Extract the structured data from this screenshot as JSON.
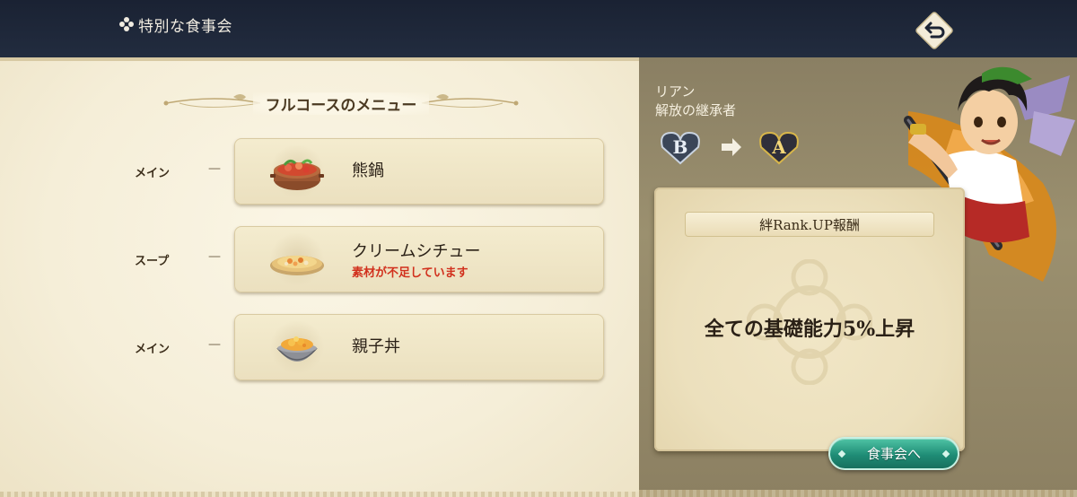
{
  "header": {
    "title": "特別な食事会",
    "title_icon": "flower-ornament-icon",
    "back_icon": "return-arrow-icon"
  },
  "menu": {
    "heading": "フルコースのメニュー",
    "courses": [
      {
        "category": "メイン",
        "dash": "—",
        "dish": "熊鍋",
        "warning": "",
        "icon": "bear-hotpot-icon"
      },
      {
        "category": "スープ",
        "dash": "—",
        "dish": "クリームシチュー",
        "warning": "素材が不足しています",
        "icon": "cream-stew-icon"
      },
      {
        "category": "メイン",
        "dash": "—",
        "dish": "親子丼",
        "warning": "",
        "icon": "oyakodon-bowl-icon"
      }
    ]
  },
  "character": {
    "name": "リアン",
    "epithet": "解放の継承者",
    "rank_from": "B",
    "rank_to": "A"
  },
  "reward": {
    "header": "絆Rank.UP報酬",
    "text": "全ての基礎能力5%上昇"
  },
  "actions": {
    "feast_button": "食事会へ"
  },
  "colors": {
    "header_bg": "#1c2434",
    "parchment": "#f5eed8",
    "right_panel": "#8a7f63",
    "warning": "#d1301d",
    "button_teal": "#1f8d76"
  }
}
